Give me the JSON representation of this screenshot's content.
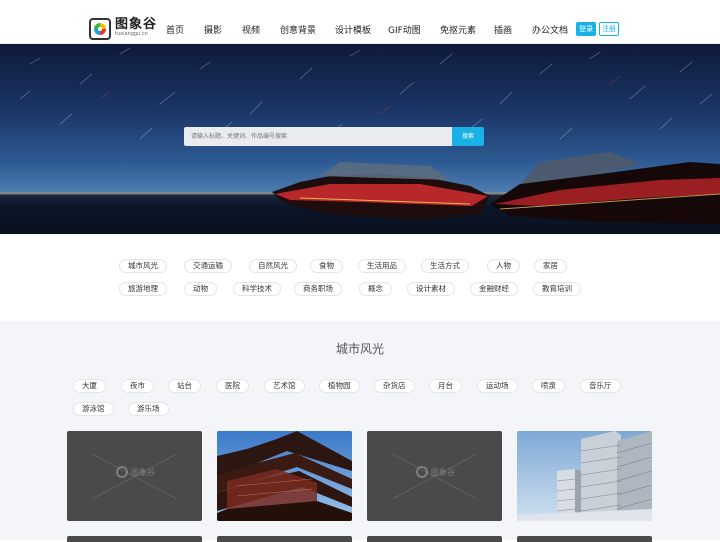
{
  "logo": {
    "name": "图象谷",
    "domain": "tuxianggu.cn"
  },
  "nav": [
    "首页",
    "摄影",
    "视频",
    "创意背景",
    "设计模板",
    "GIF动图",
    "免抠元素",
    "插画",
    "办公文档"
  ],
  "auth": {
    "login": "登录",
    "register": "注册"
  },
  "search": {
    "placeholder": "请输入标题、关键词、作品编号搜索",
    "button": "搜索"
  },
  "categories": {
    "row1": [
      "城市风光",
      "交通运输",
      "自然风光",
      "食物",
      "生活用品",
      "生活方式",
      "人物",
      "家居"
    ],
    "row2": [
      "旅游地理",
      "动物",
      "科学技术",
      "商务职场",
      "概念",
      "设计素材",
      "金融财经",
      "教育培训"
    ]
  },
  "section": {
    "title": "城市风光",
    "tags_row1": [
      "大厦",
      "夜市",
      "站台",
      "医院",
      "艺术馆",
      "植物园",
      "杂货店",
      "月台",
      "运动场",
      "喷泉",
      "音乐厅"
    ],
    "tags_row2": [
      "游泳馆",
      "游乐场"
    ],
    "placeholder_logo": "图象谷"
  },
  "colors": {
    "accent": "#1ab2e6",
    "section_bg": "#f4f5f8",
    "placeholder": "#4a4a4a"
  },
  "icons": [
    "logo-icon",
    "placeholder-logo-icon"
  ]
}
